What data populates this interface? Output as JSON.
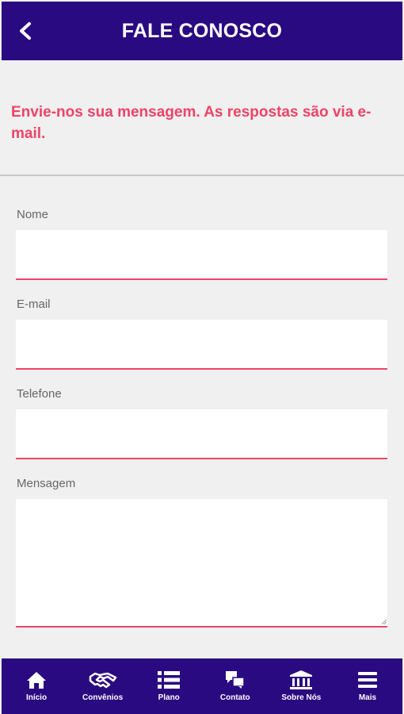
{
  "header": {
    "title": "FALE CONOSCO",
    "back_icon": "chevron-left-icon"
  },
  "intro": {
    "text": "Envie-nos sua mensagem. As respostas são via e-mail."
  },
  "form": {
    "name_label": "Nome",
    "name_value": "",
    "email_label": "E-mail",
    "email_value": "",
    "phone_label": "Telefone",
    "phone_value": "",
    "message_label": "Mensagem",
    "message_value": ""
  },
  "nav": {
    "items": [
      {
        "label": "Início",
        "icon": "home-icon"
      },
      {
        "label": "Convênios",
        "icon": "handshake-icon"
      },
      {
        "label": "Plano",
        "icon": "list-icon"
      },
      {
        "label": "Contato",
        "icon": "chat-icon"
      },
      {
        "label": "Sobre Nós",
        "icon": "bank-icon"
      },
      {
        "label": "Mais",
        "icon": "menu-icon"
      }
    ]
  },
  "colors": {
    "primary": "#2a0a80",
    "accent": "#ee4466",
    "background": "#f0f0f0"
  }
}
